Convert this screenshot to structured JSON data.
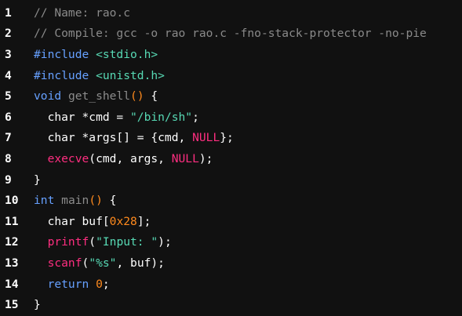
{
  "colors": {
    "background": "#111111",
    "comment": "#8a8a8a",
    "keyword": "#66a0ff",
    "include": "#57d9b4",
    "function": "#8c8c8c",
    "paren": "#ff8a1d",
    "string": "#57d9b4",
    "null": "#ff2e80",
    "call": "#ff2e80",
    "number": "#ff8a1d",
    "plain": "#ffffff"
  },
  "lines": [
    {
      "num": "1",
      "tokens": [
        {
          "t": "comment",
          "v": "// Name: rao.c"
        }
      ]
    },
    {
      "num": "2",
      "tokens": [
        {
          "t": "comment",
          "v": "// Compile: gcc -o rao rao.c -fno-stack-protector -no-pie"
        }
      ]
    },
    {
      "num": "3",
      "tokens": [
        {
          "t": "preproc",
          "v": "#include "
        },
        {
          "t": "include",
          "v": "<stdio.h>"
        }
      ]
    },
    {
      "num": "4",
      "tokens": [
        {
          "t": "preproc",
          "v": "#include "
        },
        {
          "t": "include",
          "v": "<unistd.h>"
        }
      ]
    },
    {
      "num": "5",
      "tokens": [
        {
          "t": "keyword",
          "v": "void"
        },
        {
          "t": "plain",
          "v": " "
        },
        {
          "t": "func",
          "v": "get_shell"
        },
        {
          "t": "paren",
          "v": "()"
        },
        {
          "t": "plain",
          "v": " {"
        }
      ]
    },
    {
      "num": "6",
      "tokens": [
        {
          "t": "plain",
          "v": "  char *cmd = "
        },
        {
          "t": "string",
          "v": "\"/bin/sh\""
        },
        {
          "t": "plain",
          "v": ";"
        }
      ]
    },
    {
      "num": "7",
      "tokens": [
        {
          "t": "plain",
          "v": "  char *args[] = {cmd, "
        },
        {
          "t": "null",
          "v": "NULL"
        },
        {
          "t": "plain",
          "v": "};"
        }
      ]
    },
    {
      "num": "8",
      "tokens": [
        {
          "t": "plain",
          "v": "  "
        },
        {
          "t": "call",
          "v": "execve"
        },
        {
          "t": "plain",
          "v": "(cmd, args, "
        },
        {
          "t": "null",
          "v": "NULL"
        },
        {
          "t": "plain",
          "v": ");"
        }
      ]
    },
    {
      "num": "9",
      "tokens": [
        {
          "t": "plain",
          "v": "}"
        }
      ]
    },
    {
      "num": "10",
      "tokens": [
        {
          "t": "keyword",
          "v": "int"
        },
        {
          "t": "plain",
          "v": " "
        },
        {
          "t": "func",
          "v": "main"
        },
        {
          "t": "paren",
          "v": "()"
        },
        {
          "t": "plain",
          "v": " {"
        }
      ]
    },
    {
      "num": "11",
      "tokens": [
        {
          "t": "plain",
          "v": "  char buf["
        },
        {
          "t": "number",
          "v": "0x28"
        },
        {
          "t": "plain",
          "v": "];"
        }
      ]
    },
    {
      "num": "12",
      "tokens": [
        {
          "t": "plain",
          "v": "  "
        },
        {
          "t": "call",
          "v": "printf"
        },
        {
          "t": "plain",
          "v": "("
        },
        {
          "t": "string",
          "v": "\"Input: \""
        },
        {
          "t": "plain",
          "v": ");"
        }
      ]
    },
    {
      "num": "13",
      "tokens": [
        {
          "t": "plain",
          "v": "  "
        },
        {
          "t": "call",
          "v": "scanf"
        },
        {
          "t": "plain",
          "v": "("
        },
        {
          "t": "string",
          "v": "\"%s\""
        },
        {
          "t": "plain",
          "v": ", buf);"
        }
      ]
    },
    {
      "num": "14",
      "tokens": [
        {
          "t": "plain",
          "v": "  "
        },
        {
          "t": "keyword",
          "v": "return"
        },
        {
          "t": "plain",
          "v": " "
        },
        {
          "t": "number",
          "v": "0"
        },
        {
          "t": "plain",
          "v": ";"
        }
      ]
    },
    {
      "num": "15",
      "tokens": [
        {
          "t": "plain",
          "v": "}"
        }
      ]
    }
  ]
}
